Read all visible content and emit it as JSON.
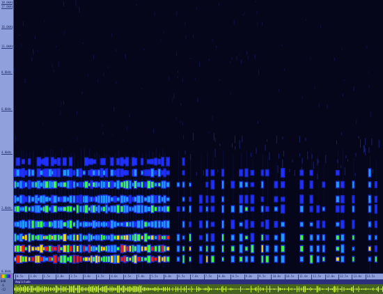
{
  "colors": {
    "background": "#05061a",
    "axis_panel": "#8fa0dc",
    "track_header": "#2c2f7e",
    "track_bg": "#46631f",
    "waveform": "#c8ef3a",
    "heat_low": "#2030ff",
    "heat_mid": "#40ff40",
    "heat_high": "#ffe000",
    "heat_peak": "#ff2000"
  },
  "freq_axis": {
    "labels": [
      "18.0kHz",
      "17.0kHz",
      "16.0kHz",
      "11.0kHz",
      "8.0kHz",
      "6.0kHz",
      "4.0kHz",
      "2.0kHz",
      "0.0kHz"
    ],
    "palette_icon": "color-palette-icon"
  },
  "time_axis": {
    "labels": [
      "0.5s",
      "1.0s",
      "1.5s",
      "2.0s",
      "2.5s",
      "3.0s",
      "3.5s",
      "4.0s",
      "4.5s",
      "5.0s",
      "5.5s",
      "6.0s",
      "6.5s",
      "7.0s",
      "7.5s",
      "8.0s",
      "8.5s",
      "9.0s",
      "9.5s",
      "10.0s",
      "10.5s",
      "11.0s",
      "11.5s",
      "12.0s",
      "12.5s",
      "13.0s",
      "13.5s"
    ]
  },
  "left_panel": {
    "vol_top": "0dB",
    "vol_mid": "-6",
    "vol_bottom": "-12"
  },
  "track": {
    "title": "Amplitude"
  }
}
